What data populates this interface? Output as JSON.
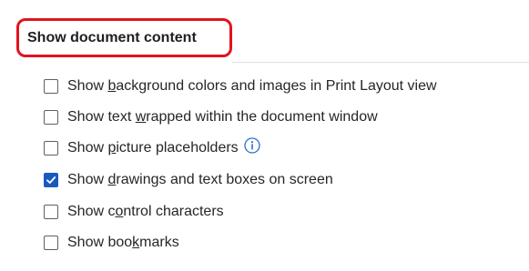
{
  "section": {
    "title": "Show document content"
  },
  "options": [
    {
      "pre": "Show ",
      "accel": "b",
      "post": "ackground colors and images in Print Layout view",
      "checked": false
    },
    {
      "pre": "Show text ",
      "accel": "w",
      "post": "rapped within the document window",
      "checked": false
    },
    {
      "pre": "Show ",
      "accel": "p",
      "post": "icture placeholders",
      "checked": false,
      "info_icon": "info-circle-icon"
    },
    {
      "pre": "Show ",
      "accel": "d",
      "post": "rawings and text boxes on screen",
      "checked": true
    },
    {
      "pre": "Show c",
      "accel": "o",
      "post": "ntrol characters",
      "checked": false
    },
    {
      "pre": "Show boo",
      "accel": "k",
      "post": "marks",
      "checked": false
    }
  ],
  "colors": {
    "highlight_border": "#e0141e",
    "checkbox_checked": "#185abd",
    "info_icon": "#2b6fce"
  }
}
